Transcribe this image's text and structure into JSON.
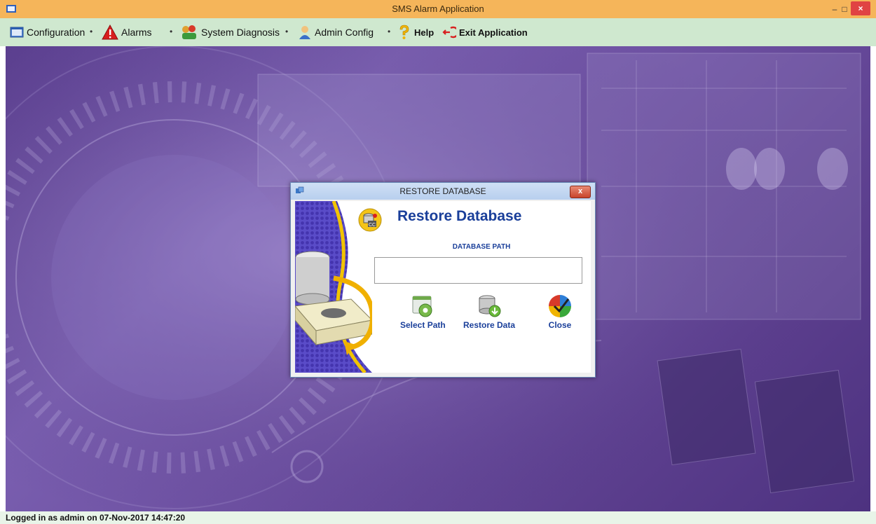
{
  "window": {
    "title": "SMS Alarm Application",
    "minimize_glyph": "–",
    "maximize_glyph": "□",
    "close_glyph": "×"
  },
  "menu": {
    "items": [
      {
        "label": "Configuration",
        "icon": "configuration-icon"
      },
      {
        "label": "Alarms",
        "icon": "alarm-warning-icon"
      },
      {
        "label": "System Diagnosis",
        "icon": "diagnosis-icon"
      },
      {
        "label": "Admin Config",
        "icon": "admin-user-icon"
      },
      {
        "label": "Help",
        "icon": "help-icon"
      },
      {
        "label": "Exit Application",
        "icon": "exit-icon"
      }
    ]
  },
  "dialog": {
    "title": "RESTORE DATABASE",
    "close_glyph": "x",
    "heading": "Restore Database",
    "path_label": "DATABASE PATH",
    "path_value": "",
    "actions": [
      {
        "label": "Select Path",
        "icon": "select-path-icon"
      },
      {
        "label": "Restore Data",
        "icon": "restore-data-icon"
      },
      {
        "label": "Close",
        "icon": "close-check-icon"
      }
    ]
  },
  "status": {
    "text": "Logged in as admin on 07-Nov-2017 14:47:20"
  },
  "colors": {
    "title_bar": "#f5b55a",
    "menu_bar": "#cfe8cf",
    "accent_text": "#1a3f9a",
    "background": "#6b4e9f"
  }
}
